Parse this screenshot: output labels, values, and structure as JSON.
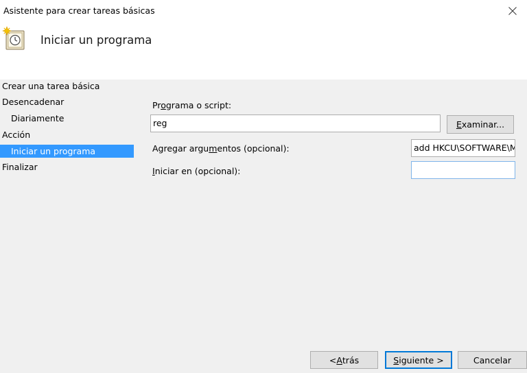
{
  "window": {
    "title": "Asistente para crear tareas básicas",
    "close_icon": "close-icon"
  },
  "header": {
    "icon": "task-scheduler-clock-icon",
    "heading": "Iniciar un programa"
  },
  "steps": [
    {
      "label": "Crear una tarea básica",
      "level": 0,
      "active": false
    },
    {
      "label": "Desencadenar",
      "level": 0,
      "active": false
    },
    {
      "label": "Diariamente",
      "level": 1,
      "active": false
    },
    {
      "label": "Acción",
      "level": 0,
      "active": false
    },
    {
      "label": "Iniciar un programa",
      "level": 1,
      "active": true
    },
    {
      "label": "Finalizar",
      "level": 0,
      "active": false
    }
  ],
  "form": {
    "program_label_pre": "Pr",
    "program_label_u": "o",
    "program_label_post": "grama o script:",
    "program_value": "reg",
    "browse_button_u": "E",
    "browse_button_post": "xaminar...",
    "args_label_pre": "Agregar argu",
    "args_label_u": "m",
    "args_label_post": "entos (opcional):",
    "args_value": "add HKCU\\SOFTWARE\\M",
    "start_in_label_pre": "",
    "start_in_label_u": "I",
    "start_in_label_post": "niciar en (opcional):",
    "start_in_value": ""
  },
  "footer": {
    "back_pre": "< ",
    "back_u": "A",
    "back_post": "trás",
    "next_u": "S",
    "next_post": "iguiente >",
    "cancel": "Cancelar"
  },
  "colors": {
    "accent": "#3399ff",
    "default_button_border": "#0078d7"
  }
}
